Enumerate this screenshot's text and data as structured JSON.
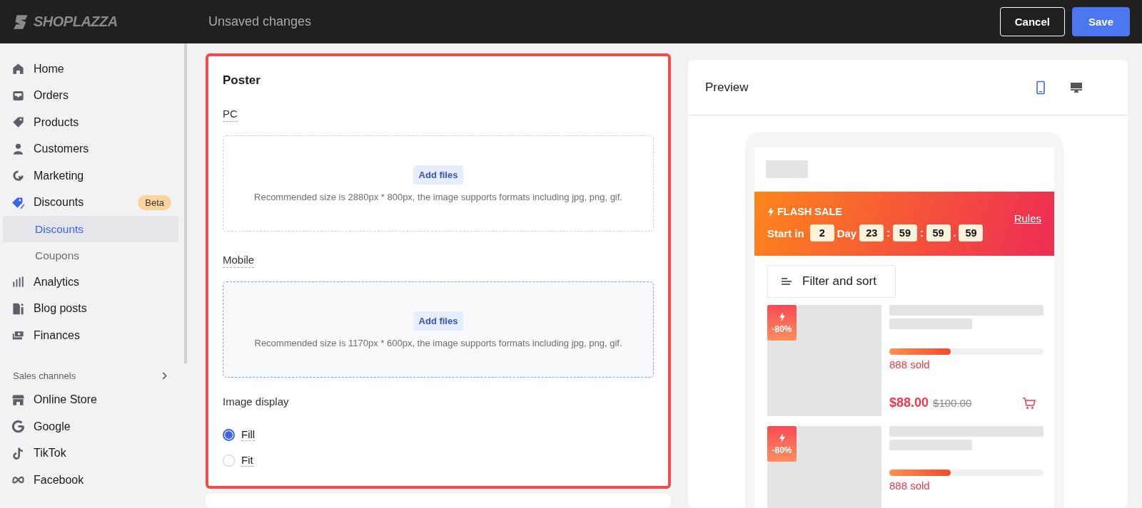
{
  "topbar": {
    "logo": "SHOPLAZZA",
    "status": "Unsaved changes",
    "buttons": [
      {
        "label": "Cancel",
        "kind": "secondary"
      },
      {
        "label": "Save",
        "kind": "primary"
      }
    ]
  },
  "sidebar": {
    "items": [
      {
        "kind": "home",
        "label": "Home",
        "selected": false
      },
      {
        "kind": "inbox",
        "label": "Orders",
        "selected": false
      },
      {
        "kind": "tag",
        "label": "Products",
        "selected": false
      },
      {
        "kind": "person",
        "label": "Customers",
        "selected": false
      },
      {
        "kind": "target",
        "label": "Marketing",
        "selected": false
      },
      {
        "kind": "discount",
        "label": "Discounts",
        "selected": false,
        "badge": "Beta",
        "children": [
          {
            "label": "Discounts",
            "selected": true
          },
          {
            "label": "Coupons",
            "selected": false
          }
        ]
      },
      {
        "kind": "bars",
        "label": "Analytics",
        "selected": false
      },
      {
        "kind": "blog",
        "label": "Blog posts",
        "selected": false
      },
      {
        "kind": "money",
        "label": "Finances",
        "selected": false
      }
    ],
    "section": {
      "title": "Sales channels",
      "items": [
        {
          "kind": "store",
          "label": "Online Store"
        },
        {
          "kind": "google",
          "label": "Google"
        },
        {
          "kind": "tiktok",
          "label": "TikTok"
        },
        {
          "kind": "meta",
          "label": "Facebook"
        }
      ]
    }
  },
  "poster": {
    "title": "Poster",
    "uploads": [
      {
        "label": "PC",
        "button": "Add files",
        "hint": "Recommended size is 2880px * 800px, the image supports formats including jpg, png, gif.",
        "hovered": false
      },
      {
        "label": "Mobile",
        "button": "Add files",
        "hint": "Recommended size is 1170px * 600px, the image supports formats including jpg, png, gif.",
        "hovered": true
      }
    ],
    "image_display": {
      "label": "Image display",
      "options": [
        {
          "label": "Fill",
          "selected": true
        },
        {
          "label": "Fit",
          "selected": false
        }
      ]
    }
  },
  "preview": {
    "title": "Preview",
    "devices": [
      {
        "kind": "mobile",
        "selected": true
      },
      {
        "kind": "desktop",
        "selected": false
      }
    ],
    "banner": {
      "title": "FLASH SALE",
      "start_label": "Start in",
      "countdown": [
        {
          "kind": "box",
          "text": "2"
        },
        {
          "kind": "label",
          "text": "Day"
        },
        {
          "kind": "box",
          "text": "23"
        },
        {
          "kind": "sep",
          "text": ":"
        },
        {
          "kind": "box",
          "text": "59"
        },
        {
          "kind": "sep",
          "text": ":"
        },
        {
          "kind": "box",
          "text": "59"
        },
        {
          "kind": "sep",
          "text": "."
        },
        {
          "kind": "box",
          "text": "59"
        }
      ],
      "link": "Rules"
    },
    "filter": "Filter and sort",
    "products": [
      {
        "badge": "-80%",
        "level": 0.4,
        "sold": "888 sold",
        "price": "$88.00",
        "old_price": "$100.00"
      },
      {
        "badge": "-80%",
        "level": 0.4,
        "sold": "888 sold"
      }
    ]
  }
}
